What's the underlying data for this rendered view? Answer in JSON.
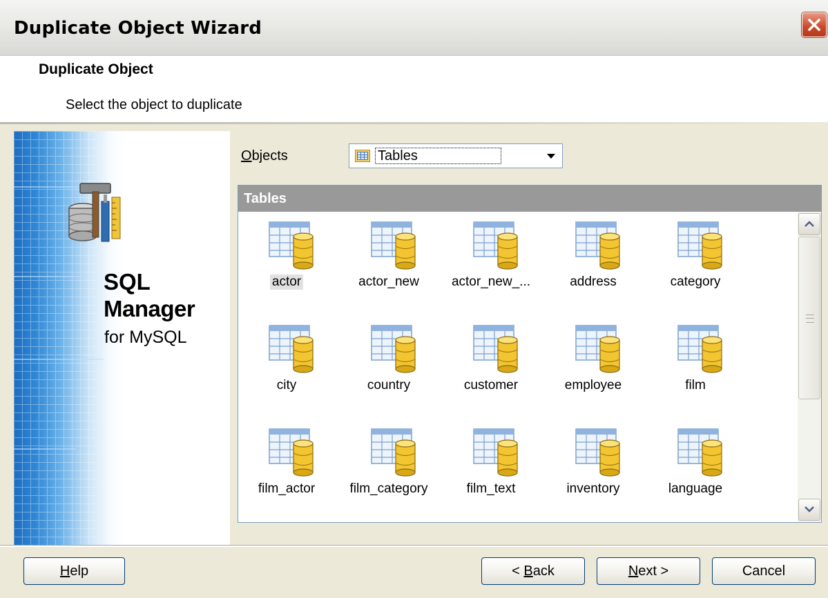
{
  "window": {
    "title": "Duplicate Object Wizard"
  },
  "header": {
    "title": "Duplicate Object",
    "subtitle": "Select the object to duplicate"
  },
  "brand": {
    "line1": "SQL",
    "line2": "Manager",
    "line3": "for MySQL"
  },
  "objects": {
    "label_first": "O",
    "label_rest": "bjects",
    "selected": "Tables"
  },
  "panel": {
    "title": "Tables",
    "items": [
      {
        "label": "actor",
        "selected": true
      },
      {
        "label": "actor_new"
      },
      {
        "label": "actor_new_..."
      },
      {
        "label": "address"
      },
      {
        "label": "category"
      },
      {
        "label": "city"
      },
      {
        "label": "country"
      },
      {
        "label": "customer"
      },
      {
        "label": "employee"
      },
      {
        "label": "film"
      },
      {
        "label": "film_actor"
      },
      {
        "label": "film_category"
      },
      {
        "label": "film_text"
      },
      {
        "label": "inventory"
      },
      {
        "label": "language"
      }
    ]
  },
  "buttons": {
    "help_first": "H",
    "help_rest": "elp",
    "back_pre": "< ",
    "back_first": "B",
    "back_rest": "ack",
    "next_first": "N",
    "next_rest": "ext >",
    "cancel": "Cancel"
  },
  "colors": {
    "panel_header": "#999999",
    "selection": "#e1e1e1",
    "close_button": "#c8492a"
  }
}
